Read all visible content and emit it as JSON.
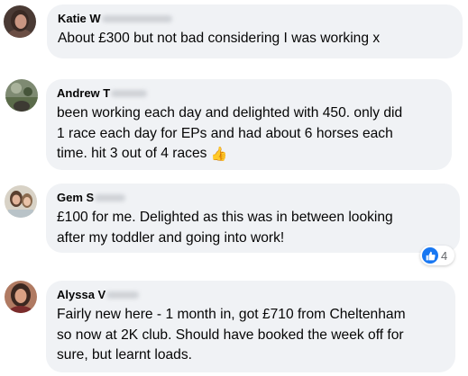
{
  "comments": [
    {
      "author": "Katie W",
      "text_lines": [
        "About £300 but not bad considering I was working x"
      ]
    },
    {
      "author": "Andrew T",
      "text_lines": [
        "been working each day and delighted with 450. only did",
        "1 race each day for EPs and had about 6 horses each",
        "time. hit 3 out of 4 races"
      ],
      "emoji": "👍"
    },
    {
      "author": "Gem S",
      "text_lines": [
        "£100 for me. Delighted as this was in between looking",
        "after my toddler and going into work!"
      ],
      "reactions": {
        "icon": "like-icon",
        "count": "4"
      }
    },
    {
      "author": "Alyssa V",
      "text_lines": [
        "Fairly new here - 1 month in, got £710 from Cheltenham",
        "so now at 2K club. Should have booked the week off for",
        "sure, but learnt loads."
      ]
    }
  ],
  "colors": {
    "bubble": "#f0f2f5",
    "text": "#050505",
    "like_blue": "#1877f2",
    "secondary_text": "#65676b"
  }
}
